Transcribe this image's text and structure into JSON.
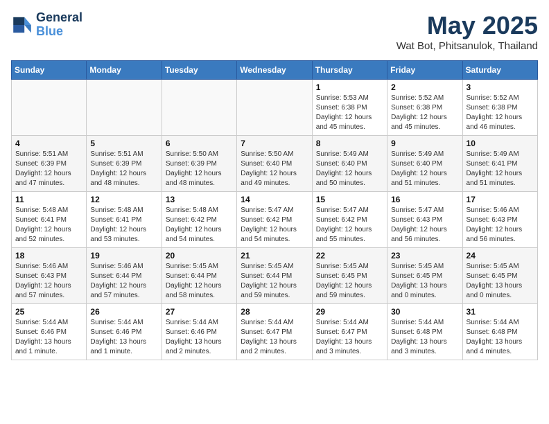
{
  "logo": {
    "line1": "General",
    "line2": "Blue"
  },
  "title": "May 2025",
  "subtitle": "Wat Bot, Phitsanulok, Thailand",
  "weekdays": [
    "Sunday",
    "Monday",
    "Tuesday",
    "Wednesday",
    "Thursday",
    "Friday",
    "Saturday"
  ],
  "weeks": [
    [
      {
        "day": "",
        "info": ""
      },
      {
        "day": "",
        "info": ""
      },
      {
        "day": "",
        "info": ""
      },
      {
        "day": "",
        "info": ""
      },
      {
        "day": "1",
        "info": "Sunrise: 5:53 AM\nSunset: 6:38 PM\nDaylight: 12 hours and 45 minutes."
      },
      {
        "day": "2",
        "info": "Sunrise: 5:52 AM\nSunset: 6:38 PM\nDaylight: 12 hours and 45 minutes."
      },
      {
        "day": "3",
        "info": "Sunrise: 5:52 AM\nSunset: 6:38 PM\nDaylight: 12 hours and 46 minutes."
      }
    ],
    [
      {
        "day": "4",
        "info": "Sunrise: 5:51 AM\nSunset: 6:39 PM\nDaylight: 12 hours and 47 minutes."
      },
      {
        "day": "5",
        "info": "Sunrise: 5:51 AM\nSunset: 6:39 PM\nDaylight: 12 hours and 48 minutes."
      },
      {
        "day": "6",
        "info": "Sunrise: 5:50 AM\nSunset: 6:39 PM\nDaylight: 12 hours and 48 minutes."
      },
      {
        "day": "7",
        "info": "Sunrise: 5:50 AM\nSunset: 6:40 PM\nDaylight: 12 hours and 49 minutes."
      },
      {
        "day": "8",
        "info": "Sunrise: 5:49 AM\nSunset: 6:40 PM\nDaylight: 12 hours and 50 minutes."
      },
      {
        "day": "9",
        "info": "Sunrise: 5:49 AM\nSunset: 6:40 PM\nDaylight: 12 hours and 51 minutes."
      },
      {
        "day": "10",
        "info": "Sunrise: 5:49 AM\nSunset: 6:41 PM\nDaylight: 12 hours and 51 minutes."
      }
    ],
    [
      {
        "day": "11",
        "info": "Sunrise: 5:48 AM\nSunset: 6:41 PM\nDaylight: 12 hours and 52 minutes."
      },
      {
        "day": "12",
        "info": "Sunrise: 5:48 AM\nSunset: 6:41 PM\nDaylight: 12 hours and 53 minutes."
      },
      {
        "day": "13",
        "info": "Sunrise: 5:48 AM\nSunset: 6:42 PM\nDaylight: 12 hours and 54 minutes."
      },
      {
        "day": "14",
        "info": "Sunrise: 5:47 AM\nSunset: 6:42 PM\nDaylight: 12 hours and 54 minutes."
      },
      {
        "day": "15",
        "info": "Sunrise: 5:47 AM\nSunset: 6:42 PM\nDaylight: 12 hours and 55 minutes."
      },
      {
        "day": "16",
        "info": "Sunrise: 5:47 AM\nSunset: 6:43 PM\nDaylight: 12 hours and 56 minutes."
      },
      {
        "day": "17",
        "info": "Sunrise: 5:46 AM\nSunset: 6:43 PM\nDaylight: 12 hours and 56 minutes."
      }
    ],
    [
      {
        "day": "18",
        "info": "Sunrise: 5:46 AM\nSunset: 6:43 PM\nDaylight: 12 hours and 57 minutes."
      },
      {
        "day": "19",
        "info": "Sunrise: 5:46 AM\nSunset: 6:44 PM\nDaylight: 12 hours and 57 minutes."
      },
      {
        "day": "20",
        "info": "Sunrise: 5:45 AM\nSunset: 6:44 PM\nDaylight: 12 hours and 58 minutes."
      },
      {
        "day": "21",
        "info": "Sunrise: 5:45 AM\nSunset: 6:44 PM\nDaylight: 12 hours and 59 minutes."
      },
      {
        "day": "22",
        "info": "Sunrise: 5:45 AM\nSunset: 6:45 PM\nDaylight: 12 hours and 59 minutes."
      },
      {
        "day": "23",
        "info": "Sunrise: 5:45 AM\nSunset: 6:45 PM\nDaylight: 13 hours and 0 minutes."
      },
      {
        "day": "24",
        "info": "Sunrise: 5:45 AM\nSunset: 6:45 PM\nDaylight: 13 hours and 0 minutes."
      }
    ],
    [
      {
        "day": "25",
        "info": "Sunrise: 5:44 AM\nSunset: 6:46 PM\nDaylight: 13 hours and 1 minute."
      },
      {
        "day": "26",
        "info": "Sunrise: 5:44 AM\nSunset: 6:46 PM\nDaylight: 13 hours and 1 minute."
      },
      {
        "day": "27",
        "info": "Sunrise: 5:44 AM\nSunset: 6:46 PM\nDaylight: 13 hours and 2 minutes."
      },
      {
        "day": "28",
        "info": "Sunrise: 5:44 AM\nSunset: 6:47 PM\nDaylight: 13 hours and 2 minutes."
      },
      {
        "day": "29",
        "info": "Sunrise: 5:44 AM\nSunset: 6:47 PM\nDaylight: 13 hours and 3 minutes."
      },
      {
        "day": "30",
        "info": "Sunrise: 5:44 AM\nSunset: 6:48 PM\nDaylight: 13 hours and 3 minutes."
      },
      {
        "day": "31",
        "info": "Sunrise: 5:44 AM\nSunset: 6:48 PM\nDaylight: 13 hours and 4 minutes."
      }
    ]
  ]
}
